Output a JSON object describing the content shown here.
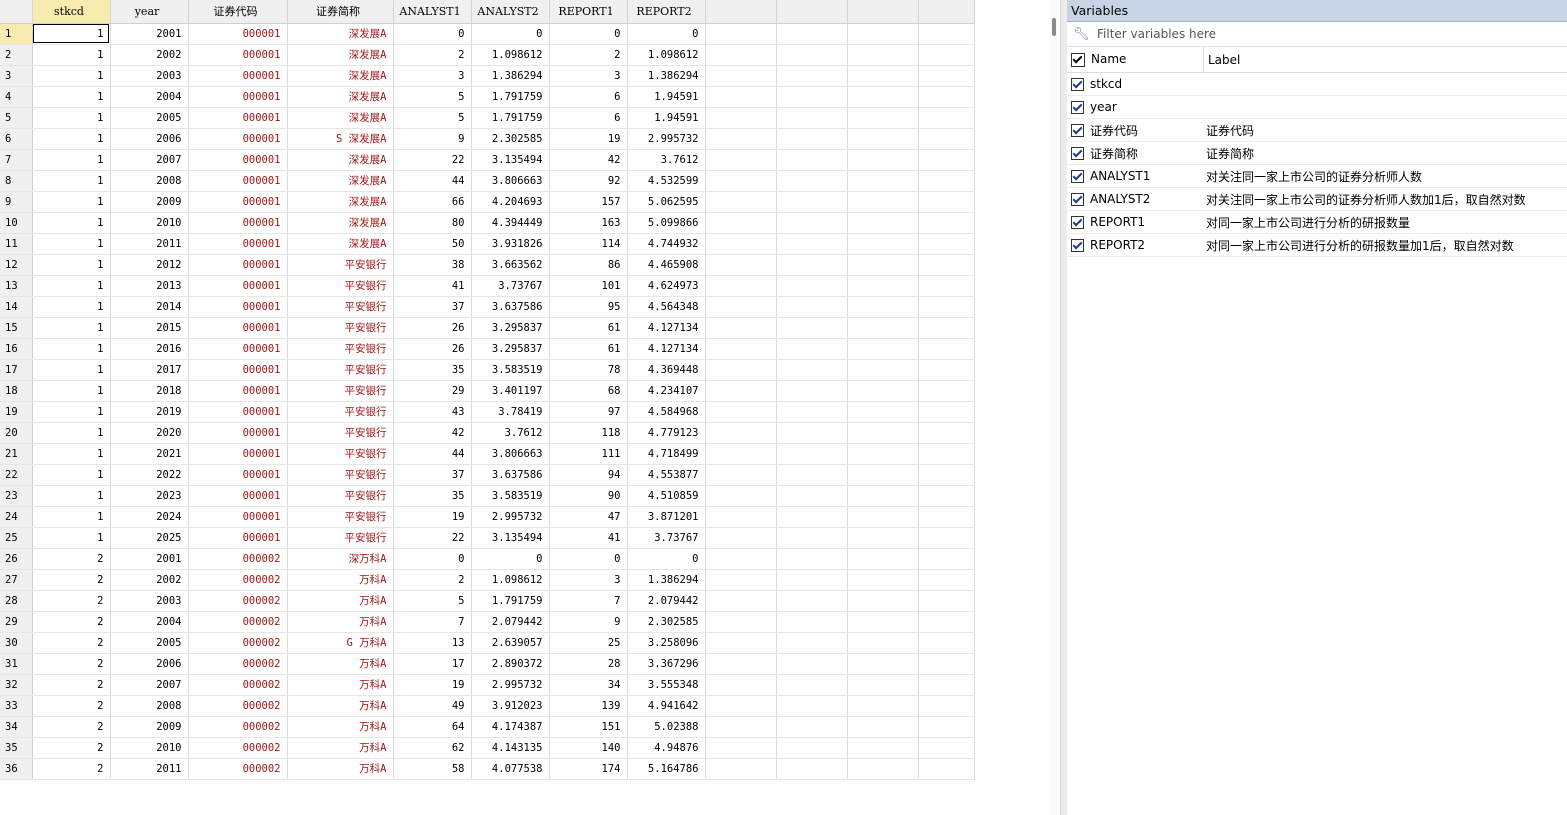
{
  "grid": {
    "columns": [
      "stkcd",
      "year",
      "证券代码",
      "证券简称",
      "ANALYST1",
      "ANALYST2",
      "REPORT1",
      "REPORT2"
    ],
    "rows": [
      [
        "1",
        "1",
        "2001",
        "000001",
        "深发展A",
        "0",
        "0",
        "0",
        "0"
      ],
      [
        "2",
        "1",
        "2002",
        "000001",
        "深发展A",
        "2",
        "1.098612",
        "2",
        "1.098612"
      ],
      [
        "3",
        "1",
        "2003",
        "000001",
        "深发展A",
        "3",
        "1.386294",
        "3",
        "1.386294"
      ],
      [
        "4",
        "1",
        "2004",
        "000001",
        "深发展A",
        "5",
        "1.791759",
        "6",
        "1.94591"
      ],
      [
        "5",
        "1",
        "2005",
        "000001",
        "深发展A",
        "5",
        "1.791759",
        "6",
        "1.94591"
      ],
      [
        "6",
        "1",
        "2006",
        "000001",
        "S 深发展A",
        "9",
        "2.302585",
        "19",
        "2.995732"
      ],
      [
        "7",
        "1",
        "2007",
        "000001",
        "深发展A",
        "22",
        "3.135494",
        "42",
        "3.7612"
      ],
      [
        "8",
        "1",
        "2008",
        "000001",
        "深发展A",
        "44",
        "3.806663",
        "92",
        "4.532599"
      ],
      [
        "9",
        "1",
        "2009",
        "000001",
        "深发展A",
        "66",
        "4.204693",
        "157",
        "5.062595"
      ],
      [
        "10",
        "1",
        "2010",
        "000001",
        "深发展A",
        "80",
        "4.394449",
        "163",
        "5.099866"
      ],
      [
        "11",
        "1",
        "2011",
        "000001",
        "深发展A",
        "50",
        "3.931826",
        "114",
        "4.744932"
      ],
      [
        "12",
        "1",
        "2012",
        "000001",
        "平安银行",
        "38",
        "3.663562",
        "86",
        "4.465908"
      ],
      [
        "13",
        "1",
        "2013",
        "000001",
        "平安银行",
        "41",
        "3.73767",
        "101",
        "4.624973"
      ],
      [
        "14",
        "1",
        "2014",
        "000001",
        "平安银行",
        "37",
        "3.637586",
        "95",
        "4.564348"
      ],
      [
        "15",
        "1",
        "2015",
        "000001",
        "平安银行",
        "26",
        "3.295837",
        "61",
        "4.127134"
      ],
      [
        "16",
        "1",
        "2016",
        "000001",
        "平安银行",
        "26",
        "3.295837",
        "61",
        "4.127134"
      ],
      [
        "17",
        "1",
        "2017",
        "000001",
        "平安银行",
        "35",
        "3.583519",
        "78",
        "4.369448"
      ],
      [
        "18",
        "1",
        "2018",
        "000001",
        "平安银行",
        "29",
        "3.401197",
        "68",
        "4.234107"
      ],
      [
        "19",
        "1",
        "2019",
        "000001",
        "平安银行",
        "43",
        "3.78419",
        "97",
        "4.584968"
      ],
      [
        "20",
        "1",
        "2020",
        "000001",
        "平安银行",
        "42",
        "3.7612",
        "118",
        "4.779123"
      ],
      [
        "21",
        "1",
        "2021",
        "000001",
        "平安银行",
        "44",
        "3.806663",
        "111",
        "4.718499"
      ],
      [
        "22",
        "1",
        "2022",
        "000001",
        "平安银行",
        "37",
        "3.637586",
        "94",
        "4.553877"
      ],
      [
        "23",
        "1",
        "2023",
        "000001",
        "平安银行",
        "35",
        "3.583519",
        "90",
        "4.510859"
      ],
      [
        "24",
        "1",
        "2024",
        "000001",
        "平安银行",
        "19",
        "2.995732",
        "47",
        "3.871201"
      ],
      [
        "25",
        "1",
        "2025",
        "000001",
        "平安银行",
        "22",
        "3.135494",
        "41",
        "3.73767"
      ],
      [
        "26",
        "2",
        "2001",
        "000002",
        "深万科A",
        "0",
        "0",
        "0",
        "0"
      ],
      [
        "27",
        "2",
        "2002",
        "000002",
        "万科A",
        "2",
        "1.098612",
        "3",
        "1.386294"
      ],
      [
        "28",
        "2",
        "2003",
        "000002",
        "万科A",
        "5",
        "1.791759",
        "7",
        "2.079442"
      ],
      [
        "29",
        "2",
        "2004",
        "000002",
        "万科A",
        "7",
        "2.079442",
        "9",
        "2.302585"
      ],
      [
        "30",
        "2",
        "2005",
        "000002",
        "G 万科A",
        "13",
        "2.639057",
        "25",
        "3.258096"
      ],
      [
        "31",
        "2",
        "2006",
        "000002",
        "万科A",
        "17",
        "2.890372",
        "28",
        "3.367296"
      ],
      [
        "32",
        "2",
        "2007",
        "000002",
        "万科A",
        "19",
        "2.995732",
        "34",
        "3.555348"
      ],
      [
        "33",
        "2",
        "2008",
        "000002",
        "万科A",
        "49",
        "3.912023",
        "139",
        "4.941642"
      ],
      [
        "34",
        "2",
        "2009",
        "000002",
        "万科A",
        "64",
        "4.174387",
        "151",
        "5.02388"
      ],
      [
        "35",
        "2",
        "2010",
        "000002",
        "万科A",
        "62",
        "4.143135",
        "140",
        "4.94876"
      ],
      [
        "36",
        "2",
        "2011",
        "000002",
        "万科A",
        "58",
        "4.077538",
        "174",
        "5.164786"
      ]
    ]
  },
  "variables": {
    "title": "Variables",
    "filter_placeholder": "Filter variables here",
    "name_header": "Name",
    "label_header": "Label",
    "items": [
      {
        "name": "stkcd",
        "label": ""
      },
      {
        "name": "year",
        "label": ""
      },
      {
        "name": "证券代码",
        "label": "证券代码"
      },
      {
        "name": "证券简称",
        "label": "证券简称"
      },
      {
        "name": "ANALYST1",
        "label": "对关注同一家上市公司的证券分析师人数"
      },
      {
        "name": "ANALYST2",
        "label": "对关注同一家上市公司的证券分析师人数加1后，取自然对数"
      },
      {
        "name": "REPORT1",
        "label": "对同一家上市公司进行分析的研报数量"
      },
      {
        "name": "REPORT2",
        "label": "对同一家上市公司进行分析的研报数量加1后，取自然对数"
      }
    ]
  }
}
